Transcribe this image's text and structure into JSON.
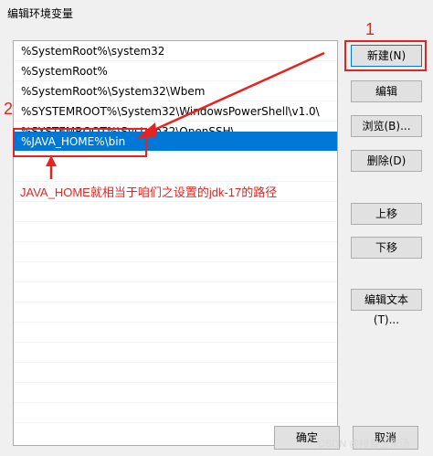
{
  "window": {
    "title": "编辑环境变量"
  },
  "path_list": [
    {
      "text": "%SystemRoot%\\system32",
      "selected": false
    },
    {
      "text": "%SystemRoot%",
      "selected": false
    },
    {
      "text": "%SystemRoot%\\System32\\Wbem",
      "selected": false
    },
    {
      "text": "%SYSTEMROOT%\\System32\\WindowsPowerShell\\v1.0\\",
      "selected": false
    },
    {
      "text": "%SYSTEMROOT%\\System32\\OpenSSH\\",
      "selected": false
    },
    {
      "text": "%JAVA_HOME%\\bin",
      "selected": true
    }
  ],
  "buttons": {
    "new": "新建(N)",
    "edit": "编辑",
    "browse": "浏览(B)...",
    "delete": "删除(D)",
    "move_up": "上移",
    "move_down": "下移",
    "edit_text": "编辑文本(T)...",
    "ok": "确定",
    "cancel": "取消"
  },
  "annotations": {
    "step1": "1",
    "step2": "2",
    "note": "JAVA_HOME就相当于咱们之设置的jdk-17的路径",
    "color": "#e8231f"
  },
  "watermark": "CSDN @排骨玉米汤"
}
